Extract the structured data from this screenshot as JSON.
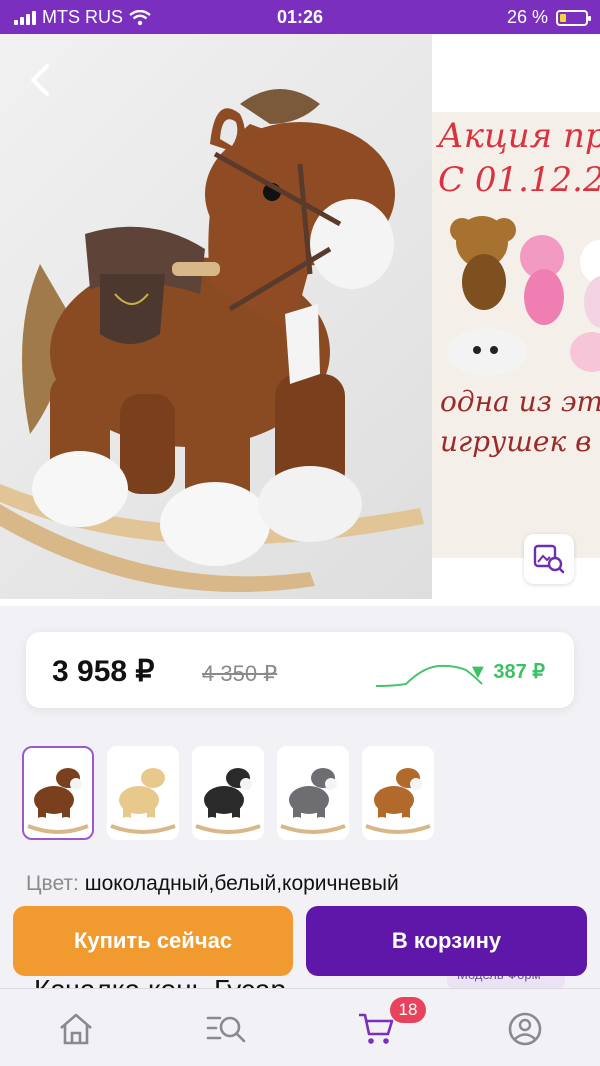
{
  "status_bar": {
    "carrier": "MTS RUS",
    "time": "01:26",
    "battery_percent": "26 %",
    "battery_level": 0.26
  },
  "colors": {
    "brand_purple": "#7b2fbf",
    "buy_orange": "#f19a2f",
    "cart_purple": "#5e17a8",
    "price_drop_green": "#3cc063",
    "badge_red": "#e8425c"
  },
  "gallery": {
    "promo_title_line1": "Акция пр",
    "promo_title_line2": "С 01.12.2",
    "promo_bottom_line1": "одна из эти",
    "promo_bottom_line2": "игрушек в",
    "icons": [
      "back-icon",
      "heart-icon",
      "share-icon",
      "visual-search-icon"
    ]
  },
  "price": {
    "current": "3 958 ₽",
    "old": "4 350 ₽",
    "drop": "387 ₽"
  },
  "thumbnails": [
    "шоколадный",
    "бежевый",
    "чёрный",
    "серый",
    "коричневый"
  ],
  "product": {
    "color_label": "Цвет:",
    "color_value": "шоколадный,белый,коричневый",
    "title_peek": "Качалка конь Гусар",
    "badge_peek": "Модель Форм"
  },
  "actions": {
    "buy_now": "Купить сейчас",
    "add_to_cart": "В корзину"
  },
  "tabbar": {
    "items": [
      "home-icon",
      "catalog-search-icon",
      "cart-icon",
      "profile-icon"
    ],
    "cart_count": "18"
  }
}
